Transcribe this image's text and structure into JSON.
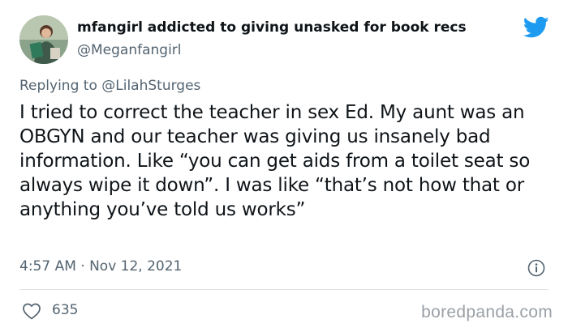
{
  "author": {
    "display_name": "mfangirl addicted to giving unasked for book recs",
    "handle": "@Meganfangirl"
  },
  "reply": {
    "prefix": "Replying to",
    "mention": "@LilahSturges"
  },
  "tweet": {
    "text": "I tried to correct the teacher in sex Ed. My aunt was an OBGYN and our teacher was giving us insanely bad information. Like “you can get aids from a toilet seat so always wipe it down”. I was like “that’s not how that or anything you’ve told us works”",
    "timestamp": "4:57 AM · Nov 12, 2021",
    "like_count": "635"
  },
  "watermark": "boredpanda.com",
  "colors": {
    "twitter_blue": "#1d9bf0",
    "text_primary": "#0f1419",
    "text_secondary": "#536471"
  },
  "icons": [
    "avatar",
    "twitter-bird-icon",
    "info-icon",
    "heart-icon"
  ]
}
